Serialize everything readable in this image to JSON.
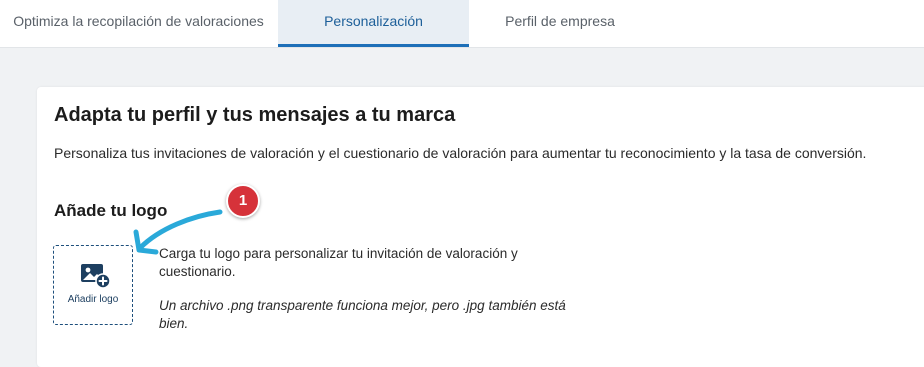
{
  "tabs": [
    {
      "label": "Optimiza la recopilación de valoraciones",
      "active": false
    },
    {
      "label": "Personalización",
      "active": true
    },
    {
      "label": "Perfil de empresa",
      "active": false
    }
  ],
  "card": {
    "title": "Adapta tu perfil y tus mensajes a tu marca",
    "description": "Personaliza tus invitaciones de valoración y el cuestionario de valoración para aumentar tu reconocimiento y la tasa de conversión.",
    "logo_section": {
      "title": "Añade tu logo",
      "upload_label": "Añadir logo",
      "upload_icon": "add-image-icon",
      "help_text": "Carga tu logo para personalizar tu invitación de valoración y cuestionario.",
      "hint_text": "Un archivo .png transparente funciona mejor, pero .jpg también está bien."
    }
  },
  "annotation": {
    "number": "1",
    "color": "#d6323a",
    "arrow_color": "#2aa9d9"
  },
  "colors": {
    "accent": "#1d6fb8",
    "active_tab_bg": "#e8eef4",
    "page_bg": "#f0f2f4"
  }
}
